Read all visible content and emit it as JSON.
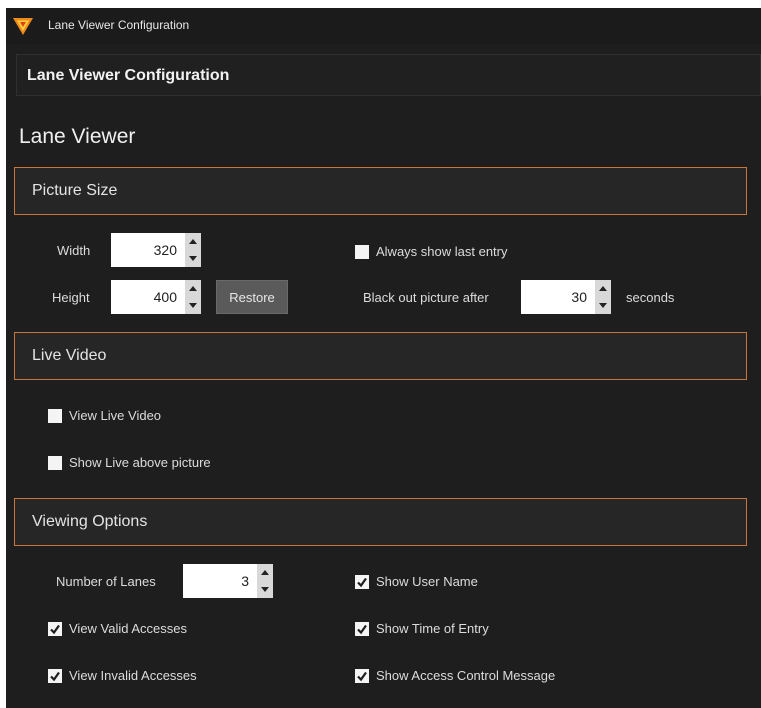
{
  "window": {
    "title": "Lane Viewer Configuration",
    "header": "Lane Viewer Configuration",
    "page_title": "Lane Viewer",
    "accent_color": "#c8763a"
  },
  "picture_size": {
    "group_label": "Picture Size",
    "width_label": "Width",
    "width_value": "320",
    "height_label": "Height",
    "height_value": "400",
    "restore_label": "Restore",
    "always_show_label": "Always show last entry",
    "always_show_checked": false,
    "blackout_label": "Black out picture after",
    "blackout_value": "30",
    "blackout_unit": "seconds"
  },
  "live_video": {
    "group_label": "Live Video",
    "view_live_label": "View Live Video",
    "view_live_checked": false,
    "show_live_label": "Show Live above picture",
    "show_live_checked": false
  },
  "viewing_options": {
    "group_label": "Viewing Options",
    "lanes_label": "Number of Lanes",
    "lanes_value": "3",
    "show_user_label": "Show User Name",
    "show_user_checked": true,
    "valid_label": "View Valid Accesses",
    "valid_checked": true,
    "time_label": "Show Time of Entry",
    "time_checked": true,
    "invalid_label": "View Invalid Accesses",
    "invalid_checked": true,
    "acm_label": "Show Access Control Message",
    "acm_checked": true
  }
}
